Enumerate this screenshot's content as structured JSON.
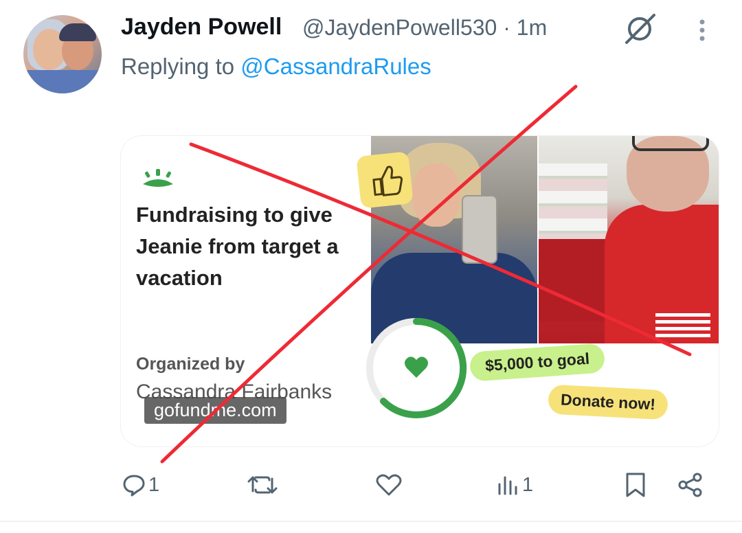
{
  "tweet": {
    "author_name": "Jayden Powell",
    "handle": "@JaydenPowell530",
    "separator": "·",
    "timestamp": "1m",
    "replying_prefix": "Replying to",
    "replying_to": "@CassandraRules"
  },
  "card": {
    "title": "Fundraising to give Jeanie from target a vacation",
    "organized_by_label": "Organized by",
    "organizer": "Cassandra Fairbanks",
    "domain": "gofundme.com",
    "goal_text": "$5,000 to goal",
    "donate_text": "Donate now!"
  },
  "actions": {
    "reply_count": "1",
    "retweet_count": "",
    "like_count": "",
    "views_count": "1"
  },
  "colors": {
    "link": "#1d9bf0",
    "muted": "#536471",
    "gofundme_green": "#3aa14a",
    "cross_red": "#ee2a35"
  },
  "icons": [
    "grok-icon",
    "more-icon",
    "gofundme-logo-icon",
    "thumbs-up-icon",
    "heart-icon",
    "reply-icon",
    "retweet-icon",
    "like-icon",
    "views-icon",
    "bookmark-icon",
    "share-icon"
  ]
}
